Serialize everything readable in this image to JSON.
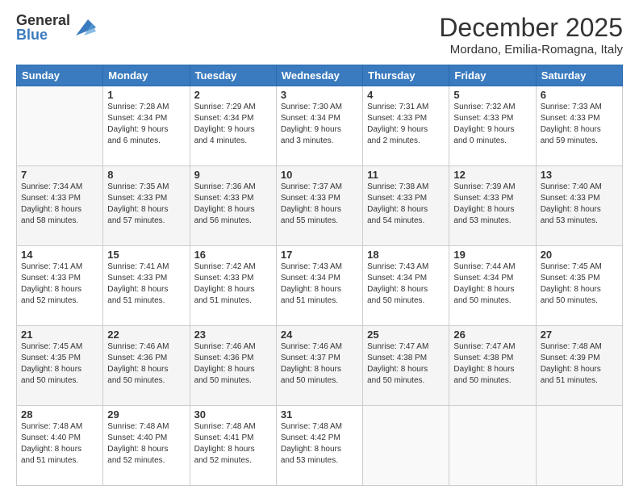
{
  "header": {
    "logo_general": "General",
    "logo_blue": "Blue",
    "month_title": "December 2025",
    "location": "Mordano, Emilia-Romagna, Italy"
  },
  "days_of_week": [
    "Sunday",
    "Monday",
    "Tuesday",
    "Wednesday",
    "Thursday",
    "Friday",
    "Saturday"
  ],
  "weeks": [
    [
      {
        "day": "",
        "info": ""
      },
      {
        "day": "1",
        "info": "Sunrise: 7:28 AM\nSunset: 4:34 PM\nDaylight: 9 hours\nand 6 minutes."
      },
      {
        "day": "2",
        "info": "Sunrise: 7:29 AM\nSunset: 4:34 PM\nDaylight: 9 hours\nand 4 minutes."
      },
      {
        "day": "3",
        "info": "Sunrise: 7:30 AM\nSunset: 4:34 PM\nDaylight: 9 hours\nand 3 minutes."
      },
      {
        "day": "4",
        "info": "Sunrise: 7:31 AM\nSunset: 4:33 PM\nDaylight: 9 hours\nand 2 minutes."
      },
      {
        "day": "5",
        "info": "Sunrise: 7:32 AM\nSunset: 4:33 PM\nDaylight: 9 hours\nand 0 minutes."
      },
      {
        "day": "6",
        "info": "Sunrise: 7:33 AM\nSunset: 4:33 PM\nDaylight: 8 hours\nand 59 minutes."
      }
    ],
    [
      {
        "day": "7",
        "info": "Sunrise: 7:34 AM\nSunset: 4:33 PM\nDaylight: 8 hours\nand 58 minutes."
      },
      {
        "day": "8",
        "info": "Sunrise: 7:35 AM\nSunset: 4:33 PM\nDaylight: 8 hours\nand 57 minutes."
      },
      {
        "day": "9",
        "info": "Sunrise: 7:36 AM\nSunset: 4:33 PM\nDaylight: 8 hours\nand 56 minutes."
      },
      {
        "day": "10",
        "info": "Sunrise: 7:37 AM\nSunset: 4:33 PM\nDaylight: 8 hours\nand 55 minutes."
      },
      {
        "day": "11",
        "info": "Sunrise: 7:38 AM\nSunset: 4:33 PM\nDaylight: 8 hours\nand 54 minutes."
      },
      {
        "day": "12",
        "info": "Sunrise: 7:39 AM\nSunset: 4:33 PM\nDaylight: 8 hours\nand 53 minutes."
      },
      {
        "day": "13",
        "info": "Sunrise: 7:40 AM\nSunset: 4:33 PM\nDaylight: 8 hours\nand 53 minutes."
      }
    ],
    [
      {
        "day": "14",
        "info": "Sunrise: 7:41 AM\nSunset: 4:33 PM\nDaylight: 8 hours\nand 52 minutes."
      },
      {
        "day": "15",
        "info": "Sunrise: 7:41 AM\nSunset: 4:33 PM\nDaylight: 8 hours\nand 51 minutes."
      },
      {
        "day": "16",
        "info": "Sunrise: 7:42 AM\nSunset: 4:33 PM\nDaylight: 8 hours\nand 51 minutes."
      },
      {
        "day": "17",
        "info": "Sunrise: 7:43 AM\nSunset: 4:34 PM\nDaylight: 8 hours\nand 51 minutes."
      },
      {
        "day": "18",
        "info": "Sunrise: 7:43 AM\nSunset: 4:34 PM\nDaylight: 8 hours\nand 50 minutes."
      },
      {
        "day": "19",
        "info": "Sunrise: 7:44 AM\nSunset: 4:34 PM\nDaylight: 8 hours\nand 50 minutes."
      },
      {
        "day": "20",
        "info": "Sunrise: 7:45 AM\nSunset: 4:35 PM\nDaylight: 8 hours\nand 50 minutes."
      }
    ],
    [
      {
        "day": "21",
        "info": "Sunrise: 7:45 AM\nSunset: 4:35 PM\nDaylight: 8 hours\nand 50 minutes."
      },
      {
        "day": "22",
        "info": "Sunrise: 7:46 AM\nSunset: 4:36 PM\nDaylight: 8 hours\nand 50 minutes."
      },
      {
        "day": "23",
        "info": "Sunrise: 7:46 AM\nSunset: 4:36 PM\nDaylight: 8 hours\nand 50 minutes."
      },
      {
        "day": "24",
        "info": "Sunrise: 7:46 AM\nSunset: 4:37 PM\nDaylight: 8 hours\nand 50 minutes."
      },
      {
        "day": "25",
        "info": "Sunrise: 7:47 AM\nSunset: 4:38 PM\nDaylight: 8 hours\nand 50 minutes."
      },
      {
        "day": "26",
        "info": "Sunrise: 7:47 AM\nSunset: 4:38 PM\nDaylight: 8 hours\nand 50 minutes."
      },
      {
        "day": "27",
        "info": "Sunrise: 7:48 AM\nSunset: 4:39 PM\nDaylight: 8 hours\nand 51 minutes."
      }
    ],
    [
      {
        "day": "28",
        "info": "Sunrise: 7:48 AM\nSunset: 4:40 PM\nDaylight: 8 hours\nand 51 minutes."
      },
      {
        "day": "29",
        "info": "Sunrise: 7:48 AM\nSunset: 4:40 PM\nDaylight: 8 hours\nand 52 minutes."
      },
      {
        "day": "30",
        "info": "Sunrise: 7:48 AM\nSunset: 4:41 PM\nDaylight: 8 hours\nand 52 minutes."
      },
      {
        "day": "31",
        "info": "Sunrise: 7:48 AM\nSunset: 4:42 PM\nDaylight: 8 hours\nand 53 minutes."
      },
      {
        "day": "",
        "info": ""
      },
      {
        "day": "",
        "info": ""
      },
      {
        "day": "",
        "info": ""
      }
    ]
  ]
}
